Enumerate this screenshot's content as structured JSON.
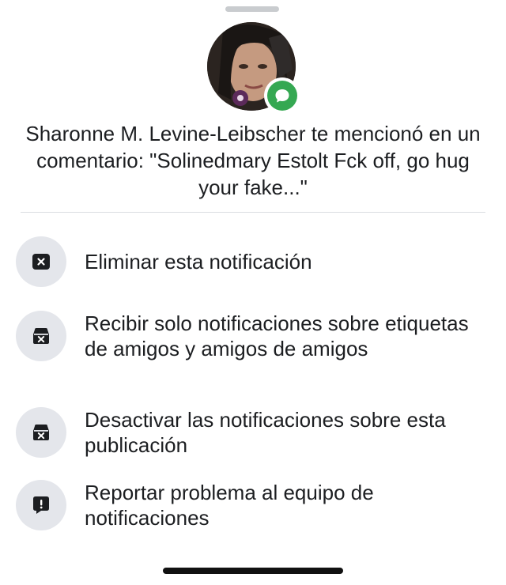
{
  "sheet": {
    "notification_text": "Sharonne M. Levine-Leibscher te mencionó en un comentario: \"Solinedmary Estolt Fck off, go hug your fake...\"",
    "avatar_badge_icon": "comment-icon",
    "badge_color": "#35a852"
  },
  "options": [
    {
      "label": "Eliminar esta notificación",
      "icon": "close-box-icon"
    },
    {
      "label": "Recibir solo notificaciones sobre etiquetas de amigos y amigos de amigos",
      "icon": "inbox-close-icon"
    },
    {
      "label": "Desactivar las notificaciones sobre esta publicación",
      "icon": "inbox-close-icon"
    },
    {
      "label": "Reportar problema al equipo de notificaciones",
      "icon": "alert-box-icon"
    }
  ]
}
